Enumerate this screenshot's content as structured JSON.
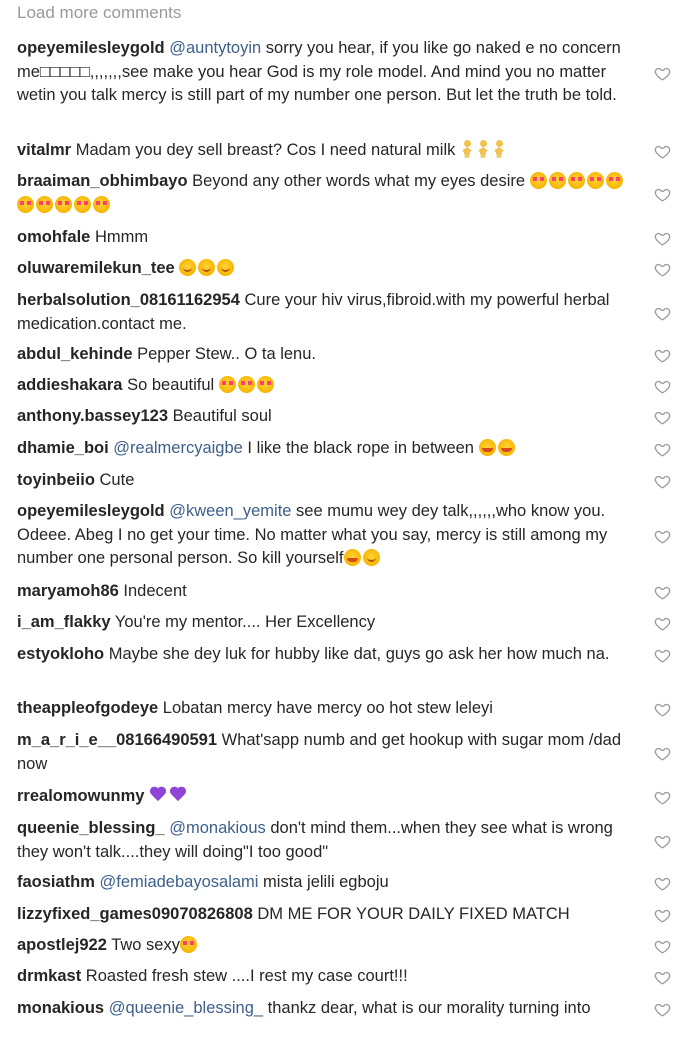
{
  "load_more": "Load more comments",
  "comments": [
    {
      "user": "opeyemilesleygold",
      "mention": "@auntytoyin",
      "text": " sorry you hear, if you like go naked e no concern me□□□□□,,,,,,,see make you hear God is my role model. And mind you no matter wetin you talk mercy is still part of my number one person. But let the truth be told.",
      "emojis": []
    },
    {
      "user": "vitalmr",
      "mention": "",
      "text": " Madam you dey sell breast? Cos I need natural milk ",
      "emojis": [
        "person",
        "person",
        "person"
      ]
    },
    {
      "user": "braaiman_obhimbayo",
      "mention": "",
      "text": " Beyond any other words what my eyes desire ",
      "emojis": [
        "heart-eyes",
        "heart-eyes",
        "heart-eyes",
        "heart-eyes",
        "heart-eyes",
        "heart-eyes",
        "heart-eyes",
        "heart-eyes",
        "heart-eyes",
        "heart-eyes"
      ]
    },
    {
      "user": "omohfale",
      "mention": "",
      "text": " Hmmm",
      "emojis": []
    },
    {
      "user": "oluwaremilekun_tee",
      "mention": "",
      "text": " ",
      "emojis": [
        "smile",
        "smile",
        "smile"
      ]
    },
    {
      "user": "herbalsolution_08161162954",
      "mention": "",
      "text": " Cure your hiv virus,fibroid.with my powerful herbal medication.contact me.",
      "emojis": []
    },
    {
      "user": "abdul_kehinde",
      "mention": "",
      "text": " Pepper Stew.. O ta lenu.",
      "emojis": []
    },
    {
      "user": "addieshakara",
      "mention": "",
      "text": " So beautiful ",
      "emojis": [
        "heart-eyes",
        "heart-eyes",
        "heart-eyes"
      ]
    },
    {
      "user": "anthony.bassey123",
      "mention": "",
      "text": " Beautiful soul",
      "emojis": []
    },
    {
      "user": "dhamie_boi",
      "mention": "@realmercyaigbe",
      "text": " I like the black rope in between ",
      "emojis": [
        "grin",
        "grin"
      ]
    },
    {
      "user": "toyinbeiio",
      "mention": "",
      "text": " Cute",
      "emojis": []
    },
    {
      "user": "opeyemilesleygold",
      "mention": "@kween_yemite",
      "text": " see mumu wey dey talk,,,,,,who know you. Odeee. Abeg I no get your time. No matter what you say, mercy is still among my number one personal person. So kill yourself",
      "emojis": [
        "grin",
        "smile"
      ]
    },
    {
      "user": "maryamoh86",
      "mention": "",
      "text": " Indecent",
      "emojis": []
    },
    {
      "user": "i_am_flakky",
      "mention": "",
      "text": " You're my mentor.... Her Excellency",
      "emojis": []
    },
    {
      "user": "estyokloho",
      "mention": "",
      "text": " Maybe she dey luk for hubby like dat, guys go ask her how much na.",
      "emojis": []
    },
    {
      "user": "theappleofgodeye",
      "mention": "",
      "text": " Lobatan mercy have mercy oo hot stew leleyi",
      "emojis": []
    },
    {
      "user": "m_a_r_i_e__08166490591",
      "mention": "",
      "text": " What'sapp numb and get hookup with sugar mom /dad now",
      "emojis": []
    },
    {
      "user": "rrealomowunmy",
      "mention": "",
      "text": " ",
      "emojis": [
        "purple-heart",
        "purple-heart"
      ]
    },
    {
      "user": "queenie_blessing_",
      "mention": "@monakious",
      "text": " don't mind them...when they see what is wrong they won't talk....they will doing\"I too good\"",
      "emojis": []
    },
    {
      "user": "faosiathm",
      "mention": "@femiadebayosalami",
      "text": " mista jelili egboju",
      "emojis": []
    },
    {
      "user": "lizzyfixed_games09070826808",
      "mention": "",
      "text": " DM ME FOR YOUR DAILY FIXED MATCH",
      "emojis": []
    },
    {
      "user": "apostlej922",
      "mention": "",
      "text": " Two sexy",
      "emojis": [
        "heart-eyes"
      ]
    },
    {
      "user": "drmkast",
      "mention": "",
      "text": " Roasted fresh stew ....I rest my case court!!!",
      "emojis": []
    },
    {
      "user": "monakious",
      "mention": "@queenie_blessing_",
      "text": " thankz dear, what is our morality turning into",
      "emojis": []
    }
  ]
}
